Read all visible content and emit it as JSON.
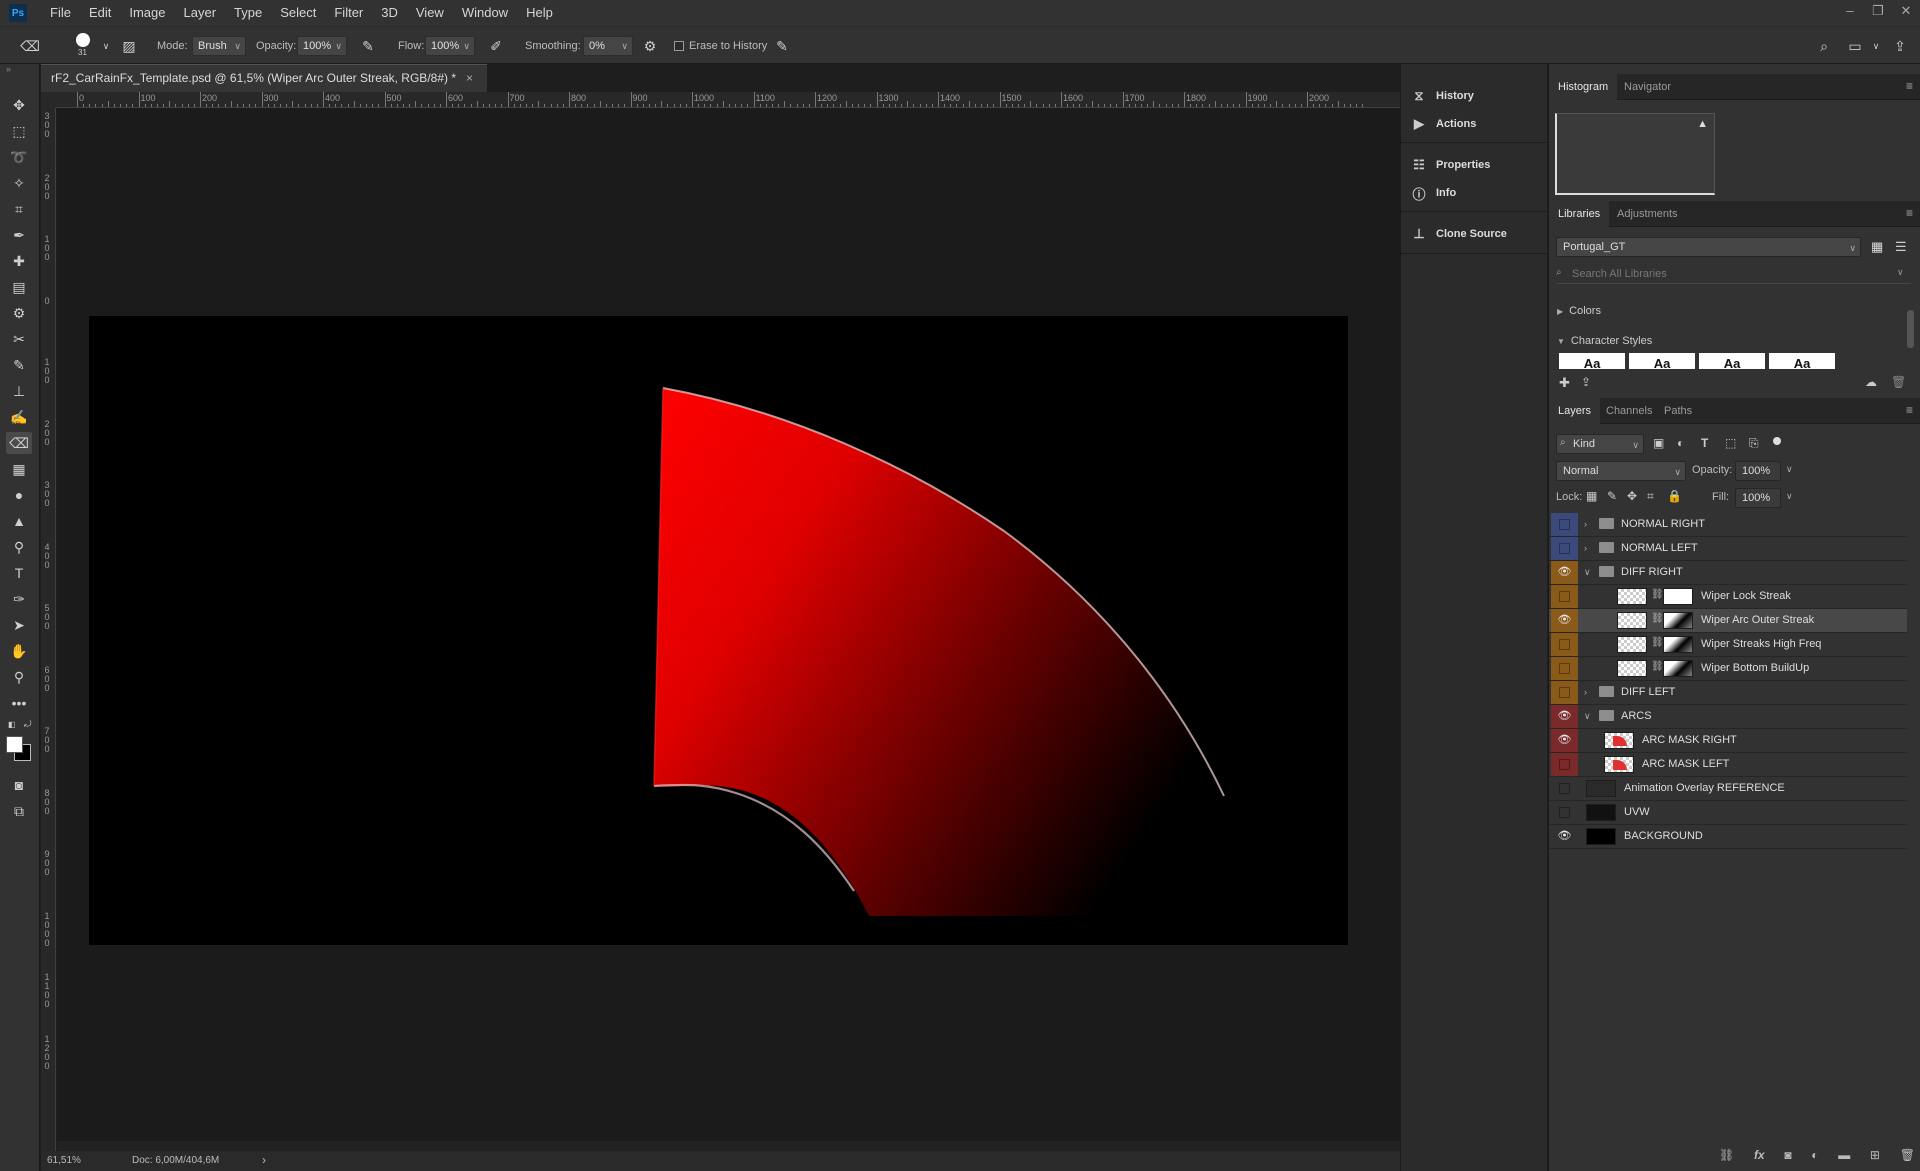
{
  "app": {
    "logo": "Ps"
  },
  "menu": [
    "File",
    "Edit",
    "Image",
    "Layer",
    "Type",
    "Select",
    "Filter",
    "3D",
    "View",
    "Window",
    "Help"
  ],
  "window_controls": [
    "–",
    "❐",
    "✕"
  ],
  "options": {
    "brush_size": "31",
    "mode_label": "Mode:",
    "mode_value": "Brush",
    "opacity_label": "Opacity:",
    "opacity_value": "100%",
    "flow_label": "Flow:",
    "flow_value": "100%",
    "smoothing_label": "Smoothing:",
    "smoothing_value": "0%",
    "erase_history_label": "Erase to History"
  },
  "document": {
    "tab_title": "rF2_CarRainFx_Template.psd @ 61,5% (Wiper Arc Outer Streak, RGB/8#) *",
    "close": "×"
  },
  "ruler": {
    "top": [
      "0",
      "100",
      "200",
      "300",
      "400",
      "500",
      "600",
      "700",
      "800",
      "900",
      "1000",
      "1100",
      "1200",
      "1300",
      "1400",
      "1500",
      "1600",
      "1700",
      "1800",
      "1900",
      "2000"
    ],
    "left": [
      "300",
      "200",
      "100",
      "0",
      "100",
      "200",
      "300",
      "400",
      "500",
      "600",
      "700",
      "800",
      "900",
      "1000",
      "1100",
      "1200"
    ]
  },
  "status": {
    "zoom": "61,51%",
    "doc": "Doc: 6,00M/404,6M",
    "arrow": "›"
  },
  "dock": [
    "History",
    "Actions",
    "Properties",
    "Info",
    "Clone Source"
  ],
  "histogram": {
    "tabs": [
      "Histogram",
      "Navigator"
    ],
    "warning": "▲"
  },
  "libraries": {
    "tabs": [
      "Libraries",
      "Adjustments"
    ],
    "library_name": "Portugal_GT",
    "search_placeholder": "Search All Libraries",
    "sections": [
      "Colors",
      "Character Styles"
    ],
    "style_preview": "Aa"
  },
  "layers_panel": {
    "tabs": [
      "Layers",
      "Channels",
      "Paths"
    ],
    "kind": "Kind",
    "blend_mode": "Normal",
    "opacity_label": "Opacity:",
    "opacity_value": "100%",
    "lock_label": "Lock:",
    "fill_label": "Fill:",
    "fill_value": "100%",
    "layers": [
      {
        "name": "NORMAL RIGHT",
        "type": "group",
        "visible": false,
        "color": "#3b4a7a",
        "expanded": false,
        "indent": 0
      },
      {
        "name": "NORMAL LEFT",
        "type": "group",
        "visible": false,
        "color": "#3b4a7a",
        "expanded": false,
        "indent": 0
      },
      {
        "name": "DIFF RIGHT",
        "type": "group",
        "visible": true,
        "color": "#8a5a18",
        "expanded": true,
        "indent": 0
      },
      {
        "name": "Wiper Lock Streak",
        "type": "masked",
        "visible": false,
        "color": "#8a5a18",
        "indent": 1
      },
      {
        "name": "Wiper Arc Outer Streak",
        "type": "masked",
        "visible": true,
        "color": "#8a5a18",
        "indent": 1,
        "selected": true
      },
      {
        "name": "Wiper Streaks High Freq",
        "type": "masked",
        "visible": false,
        "color": "#8a5a18",
        "indent": 1
      },
      {
        "name": "Wiper Bottom BuildUp",
        "type": "masked",
        "visible": false,
        "color": "#8a5a18",
        "indent": 1
      },
      {
        "name": "DIFF LEFT",
        "type": "group",
        "visible": false,
        "color": "#8a5a18",
        "expanded": false,
        "indent": 0
      },
      {
        "name": "ARCS",
        "type": "group",
        "visible": true,
        "color": "#7a2a2a",
        "expanded": true,
        "indent": 0
      },
      {
        "name": "ARC MASK RIGHT",
        "type": "layer",
        "visible": true,
        "color": "#7a2a2a",
        "indent": 1
      },
      {
        "name": "ARC MASK LEFT",
        "type": "layer",
        "visible": false,
        "color": "#7a2a2a",
        "indent": 1
      },
      {
        "name": "Animation Overlay REFERENCE",
        "type": "layer",
        "visible": false,
        "color": "",
        "indent": 0
      },
      {
        "name": "UVW",
        "type": "layer",
        "visible": false,
        "color": "",
        "indent": 0
      },
      {
        "name": "BACKGROUND",
        "type": "layer",
        "visible": true,
        "color": "",
        "indent": 0
      }
    ],
    "footer_icons": [
      "link-icon",
      "fx-icon",
      "mask-icon",
      "adjustment-icon",
      "folder-icon",
      "new-layer-icon",
      "trash-icon"
    ]
  },
  "colors": {
    "foreground": "#ffffff",
    "background": "#000000",
    "art_red": "#ff0000"
  }
}
